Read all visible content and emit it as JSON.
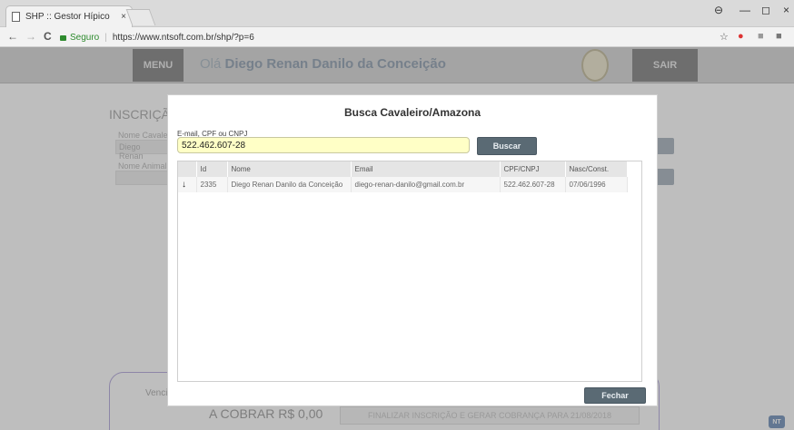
{
  "browser": {
    "tab_title": "SHP :: Gestor Hípico",
    "tab_close": "×",
    "nav": {
      "back": "←",
      "forward": "→",
      "reload": "C"
    },
    "secure_label": "Seguro",
    "url": "https://www.ntsoft.com.br/shp/?p=6",
    "window_controls": {
      "account": "⊖",
      "minimize": "—",
      "maximize": "◻",
      "close": "×"
    },
    "toolbar_icons": [
      "star-icon",
      "abp-icon",
      "extension-icon",
      "extension-icon"
    ]
  },
  "header": {
    "menu_label": "MENU",
    "greeting_prefix": "Olá",
    "user_name": "Diego Renan Danilo da Conceição",
    "logout_label": "SAIR"
  },
  "background": {
    "title": "INSCRIÇÃ",
    "rider_label": "Nome Cavaleir",
    "rider_value": "Diego Renan",
    "animal_label": "Nome Animal",
    "due_label": "Venci",
    "charge_text": "A COBRAR R$ 0,00",
    "finalize_label": "FINALIZAR INSCRIÇÃO E GERAR COBRANÇA PARA 21/08/2018",
    "logo_text": "NT"
  },
  "modal": {
    "title": "Busca Cavaleiro/Amazona",
    "search_label": "E-mail, CPF ou CNPJ",
    "search_value": "522.462.607-28",
    "search_button": "Buscar",
    "close_button": "Fechar",
    "columns": [
      "Id",
      "Nome",
      "Email",
      "CPF/CNPJ",
      "Nasc/Const."
    ],
    "rows": [
      {
        "select_icon": "↓",
        "id": "2335",
        "name": "Diego Renan Danilo da Conceição",
        "email": "diego-renan-danilo@gmail.com.br",
        "doc": "522.462.607-28",
        "birth": "07/06/1996"
      }
    ]
  },
  "colors": {
    "header_band": "#cfcfcf",
    "button_dark": "#5a6a74",
    "input_highlight": "#ffffc6",
    "overlay": "rgba(110,110,110,0.45)"
  }
}
